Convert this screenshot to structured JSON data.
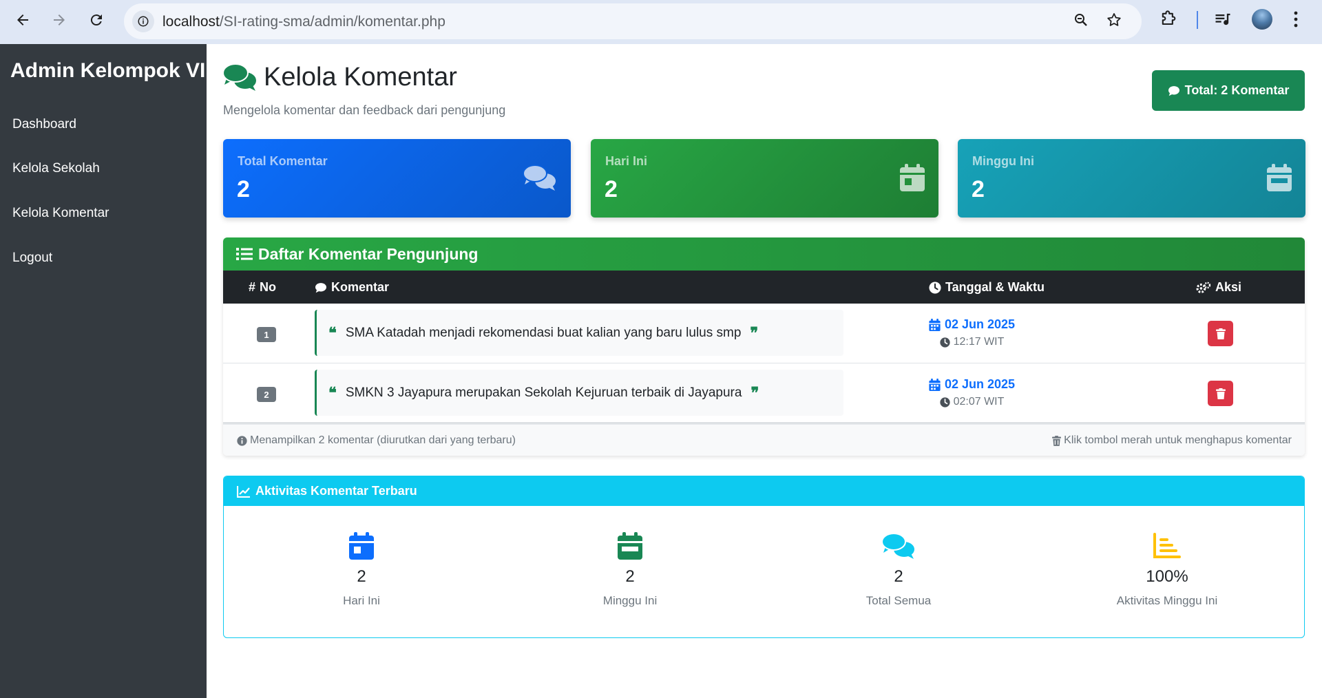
{
  "browser": {
    "url_host": "localhost",
    "url_path": "/SI-rating-sma/admin/komentar.php"
  },
  "sidebar": {
    "title": "Admin Kelompok VII",
    "items": [
      {
        "label": "Dashboard"
      },
      {
        "label": "Kelola Sekolah"
      },
      {
        "label": "Kelola Komentar"
      },
      {
        "label": "Logout"
      }
    ]
  },
  "header": {
    "title": "Kelola Komentar",
    "subtitle": "Mengelola komentar dan feedback dari pengunjung",
    "total_badge": "Total: 2 Komentar"
  },
  "stats": [
    {
      "label": "Total Komentar",
      "value": "2",
      "icon": "comments-icon"
    },
    {
      "label": "Hari Ini",
      "value": "2",
      "icon": "calendar-day-icon"
    },
    {
      "label": "Minggu Ini",
      "value": "2",
      "icon": "calendar-week-icon"
    }
  ],
  "comments": {
    "title": "Daftar Komentar Pengunjung",
    "columns": {
      "no": "No",
      "comment": "Komentar",
      "datetime": "Tanggal & Waktu",
      "action": "Aksi"
    },
    "rows": [
      {
        "no": "1",
        "text": "SMA Katadah menjadi rekomendasi buat kalian yang baru lulus smp",
        "date": "02 Jun 2025",
        "time": "12:17 WIT"
      },
      {
        "no": "2",
        "text": "SMKN 3 Jayapura merupakan Sekolah Kejuruan terbaik di Jayapura",
        "date": "02 Jun 2025",
        "time": "02:07 WIT"
      }
    ],
    "footer_left": "Menampilkan 2 komentar (diurutkan dari yang terbaru)",
    "footer_right": "Klik tombol merah untuk menghapus komentar"
  },
  "activity": {
    "title": "Aktivitas Komentar Terbaru",
    "items": [
      {
        "value": "2",
        "label": "Hari Ini",
        "icon": "calendar-day-icon"
      },
      {
        "value": "2",
        "label": "Minggu Ini",
        "icon": "calendar-week-icon"
      },
      {
        "value": "2",
        "label": "Total Semua",
        "icon": "comments-icon"
      },
      {
        "value": "100%",
        "label": "Aktivitas Minggu Ini",
        "icon": "chart-line-icon"
      }
    ]
  },
  "colors": {
    "primary": "#0d6efd",
    "success": "#198754",
    "info": "#0dcaf0",
    "danger": "#dc3545",
    "warning": "#ffc107",
    "sidebar": "#343a40"
  }
}
